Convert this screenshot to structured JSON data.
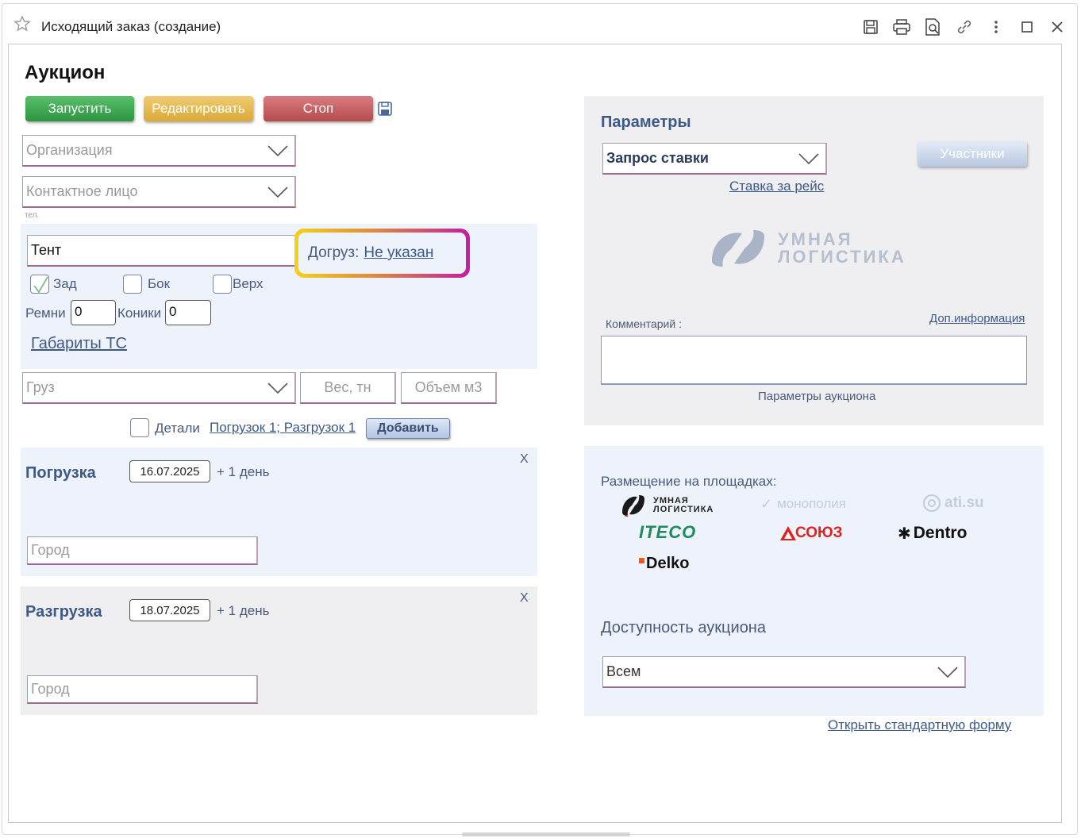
{
  "window": {
    "title": "Исходящий заказ (создание)",
    "toolbar_icons": [
      "star-icon",
      "save-icon",
      "print-icon",
      "preview-icon",
      "link-icon",
      "more-icon",
      "maximize-icon",
      "close-icon"
    ]
  },
  "auction": {
    "title": "Аукцион",
    "buttons": {
      "start": "Запустить",
      "edit": "Редактировать",
      "stop": "Стоп"
    },
    "colors": {
      "start": "#3aa44a",
      "edit": "#e2b64d",
      "stop": "#c5575b",
      "focus_ring_start": "#f2d21c",
      "focus_ring_end": "#c11fa0"
    },
    "organization_placeholder": "Организация",
    "contact_placeholder": "Контактное лицо",
    "phone_label": "тел.",
    "vehicle": {
      "body_type": "Тент",
      "load_label": "Догруз:",
      "load_value": "Не указан",
      "checkboxes": [
        {
          "label": "Зад",
          "checked": true
        },
        {
          "label": "Бок",
          "checked": false
        },
        {
          "label": "Верх",
          "checked": false
        }
      ],
      "straps_label": "Ремни",
      "straps_value": "0",
      "cones_label": "Коники",
      "cones_value": "0",
      "dimensions_link": "Габариты ТС"
    },
    "cargo": {
      "cargo_placeholder": "Груз",
      "weight_placeholder": "Вес, тн",
      "volume_placeholder": "Объем м3"
    },
    "details": {
      "label": "Детали",
      "summary_link": "Погрузок 1; Разгрузок 1",
      "add_button": "Добавить"
    },
    "loading": {
      "title": "Погрузка",
      "date": "16.07.2025",
      "plus_days": "+ 1 день",
      "city_placeholder": "Город",
      "close": "X"
    },
    "unloading": {
      "title": "Разгрузка",
      "date": "18.07.2025",
      "plus_days": "+ 1 день",
      "city_placeholder": "Город",
      "close": "X"
    }
  },
  "parameters": {
    "title": "Параметры",
    "request_type": "Запрос ставки",
    "rate_link": "Ставка за рейс",
    "participants_button": "Участники",
    "logo_text_line1": "УМНАЯ",
    "logo_text_line2": "ЛОГИСТИКА",
    "comment_label": "Комментарий :",
    "extra_info_link": "Доп.информация",
    "auction_params_label": "Параметры аукциона"
  },
  "placement": {
    "title": "Размещение на площадках:",
    "platforms": [
      {
        "name": "УМНАЯ ЛОГИСТИКА",
        "line1": "УМНАЯ",
        "line2": "ЛОГИСТИКА",
        "active": true
      },
      {
        "name": "монополия",
        "active": false
      },
      {
        "name": "ati.su",
        "active": false
      },
      {
        "name": "ITECO",
        "active": true
      },
      {
        "name": "СОЮЗ",
        "active": true
      },
      {
        "name": "Dentro",
        "active": true
      },
      {
        "name": "Delko",
        "active": true
      }
    ],
    "availability_title": "Доступность аукциона",
    "availability_value": "Всем",
    "open_standard_link": "Открыть стандартную форму"
  }
}
